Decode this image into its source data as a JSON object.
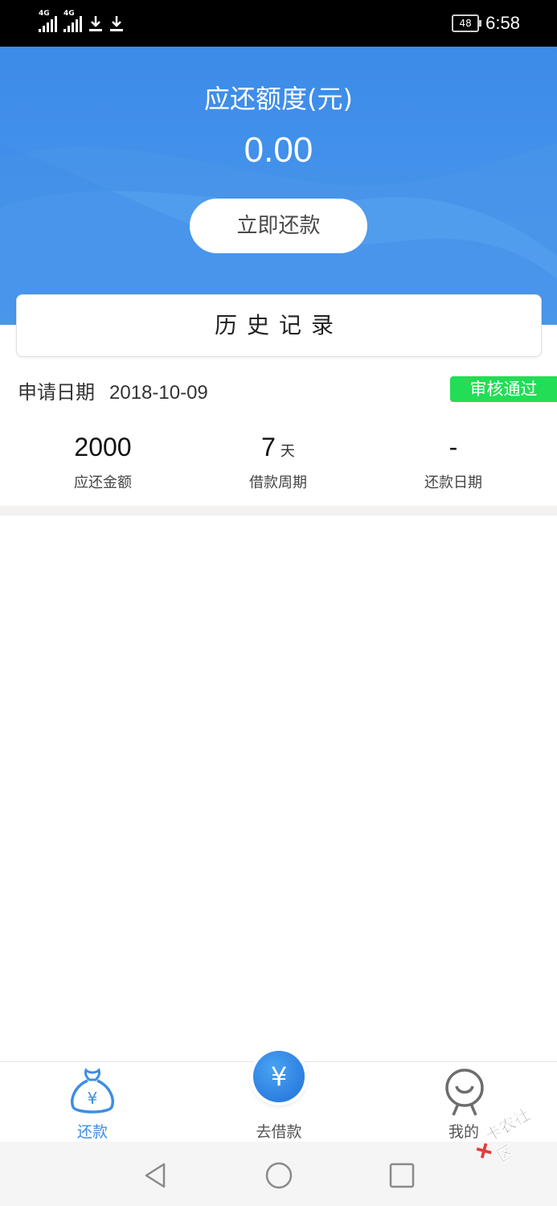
{
  "status_bar": {
    "signal_1": "4G",
    "signal_2": "4G",
    "battery": "48",
    "time": "6:58"
  },
  "hero": {
    "title": "应还额度(元)",
    "amount": "0.00",
    "repay_button": "立即还款"
  },
  "history": {
    "label": "历史记录"
  },
  "loan": {
    "apply_label": "申请日期",
    "apply_date": "2018-10-09",
    "status": "审核通过",
    "status_color": "#22dd55",
    "stats": [
      {
        "value": "2000",
        "unit": "",
        "label": "应还金额"
      },
      {
        "value": "7",
        "unit": "天",
        "label": "借款周期"
      },
      {
        "value": "-",
        "unit": "",
        "label": "还款日期"
      }
    ]
  },
  "tab_bar": {
    "repay": "还款",
    "borrow": "去借款",
    "borrow_icon": "¥",
    "mine": "我的",
    "active_color": "#3b8ee6"
  },
  "watermark": {
    "text": "卡农社区"
  }
}
